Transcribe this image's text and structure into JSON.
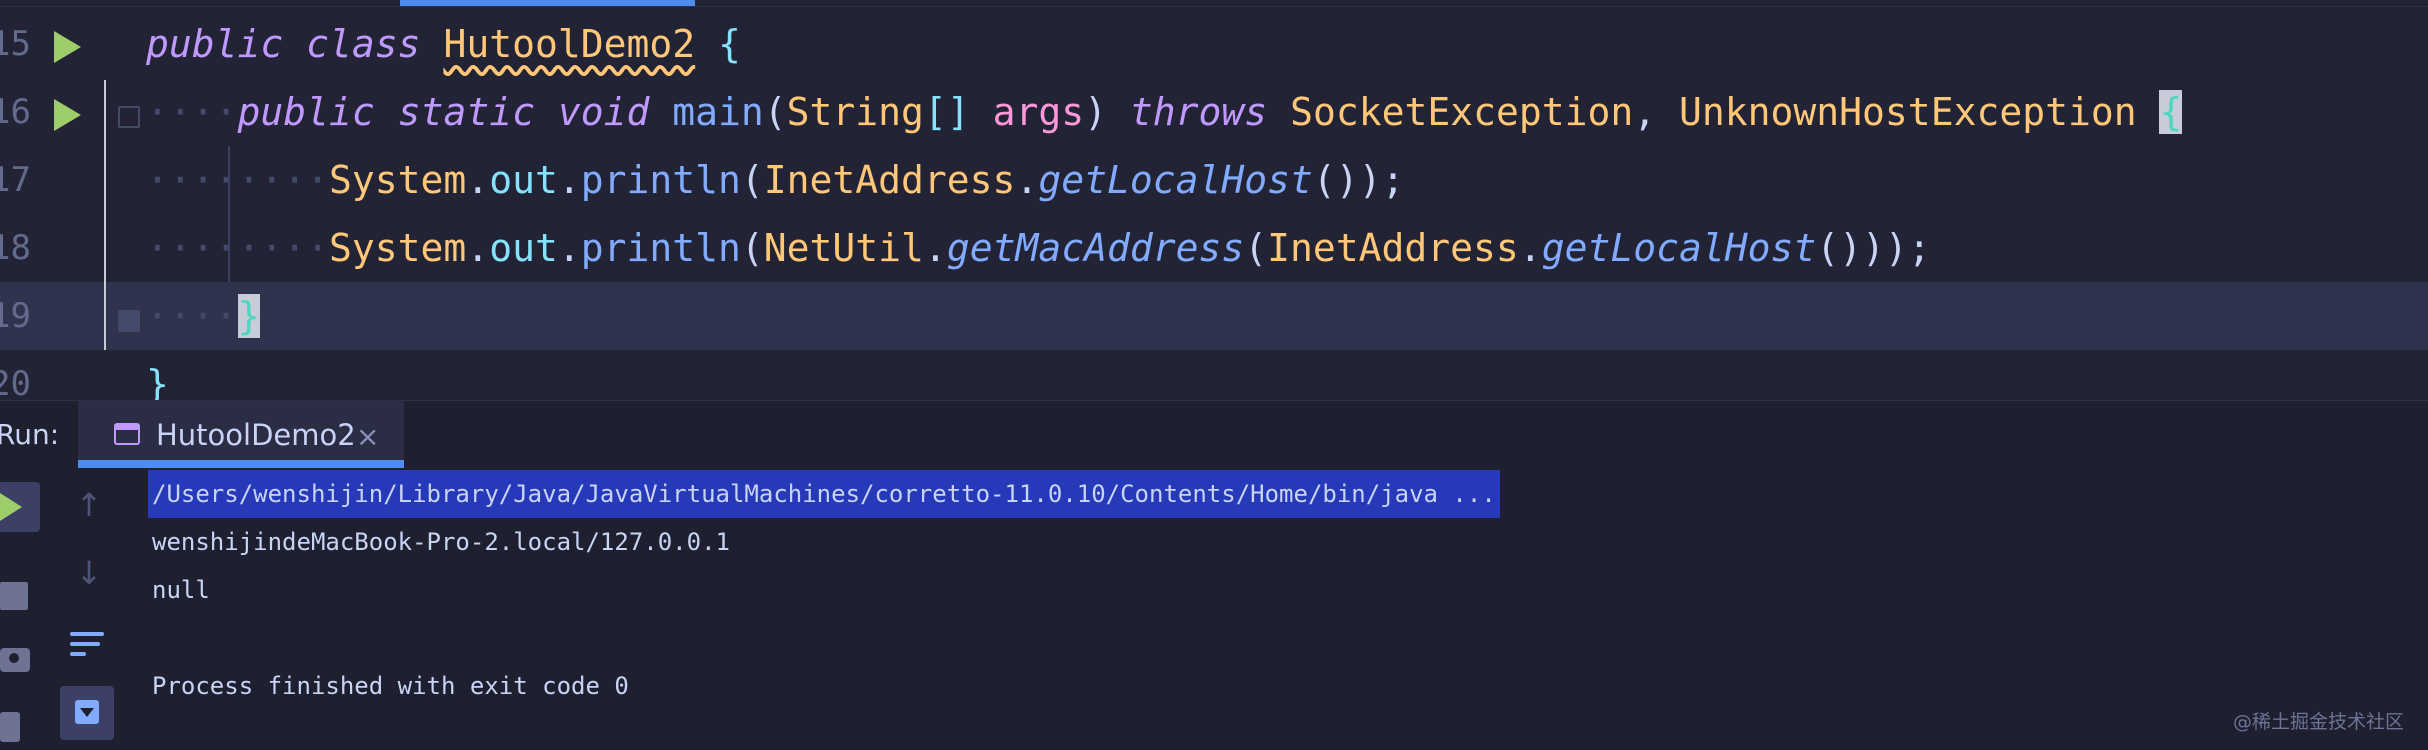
{
  "editor": {
    "lines": [
      {
        "number": "15",
        "has_run_icon": true
      },
      {
        "number": "16",
        "has_run_icon": true
      },
      {
        "number": "17",
        "has_run_icon": false
      },
      {
        "number": "18",
        "has_run_icon": false
      },
      {
        "number": "19",
        "has_run_icon": false,
        "current": true
      },
      {
        "number": "20",
        "has_run_icon": false
      }
    ],
    "tokens": {
      "public": "public",
      "class": "class",
      "static": "static",
      "void": "void",
      "throws": "throws",
      "class_name": "HutoolDemo2",
      "main": "main",
      "string_type": "String",
      "array_brackets": "[]",
      "args": "args",
      "socket_exception": "SocketException",
      "unknown_host_exception": "UnknownHostException",
      "system": "System",
      "out": "out",
      "println": "println",
      "inet_address": "InetAddress",
      "get_local_host": "getLocalHost",
      "net_util": "NetUtil",
      "get_mac_address": "getMacAddress",
      "open_brace": "{",
      "close_brace": "}",
      "dot": ".",
      "comma": ",",
      "open_paren": "(",
      "close_paren": ")",
      "semicolon": ";",
      "indent_dots_1": "····",
      "indent_dots_2": "········"
    }
  },
  "run_panel": {
    "label": "Run:",
    "tab_label": "HutoolDemo2",
    "tab_close": "×",
    "output": [
      "/Users/wenshijin/Library/Java/JavaVirtualMachines/corretto-11.0.10/Contents/Home/bin/java ...",
      "wenshijindeMacBook-Pro-2.local/127.0.0.1",
      "null",
      "",
      "Process finished with exit code 0"
    ],
    "arrow_up": "↑",
    "arrow_down": "↓"
  },
  "watermark": "@稀土掘金技术社区",
  "colors": {
    "background": "#222436",
    "keyword": "#c099ff",
    "class": "#ffc777",
    "method": "#82aaff",
    "field": "#86e1fc",
    "param": "#ff98d8",
    "run_green": "#9ece6a",
    "selection": "#2639b8",
    "accent": "#4f8cf0"
  }
}
